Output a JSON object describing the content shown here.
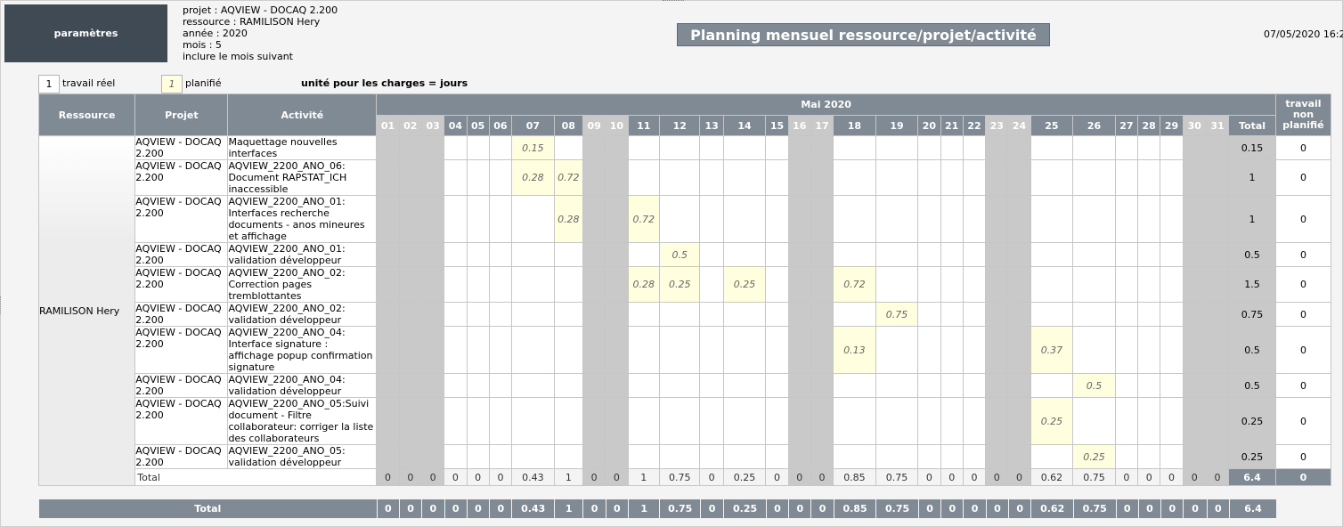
{
  "header": {
    "params_button": "paramètres",
    "info_lines": [
      "projet : AQVIEW - DOCAQ 2.200",
      "ressource : RAMILISON Hery",
      "année : 2020",
      "mois : 5",
      "inclure le mois suivant"
    ],
    "title": "Planning mensuel ressource/projet/activité",
    "datetime": "07/05/2020 16:2"
  },
  "legend": {
    "real_value": "1",
    "real_label": "travail réel",
    "planned_value": "1",
    "planned_label": "planifié",
    "unit_text": "unité pour les charges = jours"
  },
  "table": {
    "col_resource": "Ressource",
    "col_project": "Projet",
    "col_activity": "Activité",
    "month_label": "Mai 2020",
    "col_total": "Total",
    "col_unplanned": "travail non planifié",
    "days": [
      "01",
      "02",
      "03",
      "04",
      "05",
      "06",
      "07",
      "08",
      "09",
      "10",
      "11",
      "12",
      "13",
      "14",
      "15",
      "16",
      "17",
      "18",
      "19",
      "20",
      "21",
      "22",
      "23",
      "24",
      "25",
      "26",
      "27",
      "28",
      "29",
      "30",
      "31"
    ],
    "weekend_indexes": [
      0,
      1,
      2,
      8,
      9,
      15,
      16,
      22,
      23,
      29,
      30
    ],
    "resource_name": "RAMILISON Hery",
    "rows": [
      {
        "project": "AQVIEW - DOCAQ 2.200",
        "activity": "Maquettage nouvelles interfaces",
        "values": {
          "07": "0.15"
        },
        "total": "0.15",
        "unplanned": "0"
      },
      {
        "project": "AQVIEW - DOCAQ 2.200",
        "activity": "AQVIEW_2200_ANO_06: Document RAPSTAT_ICH inaccessible",
        "values": {
          "07": "0.28",
          "08": "0.72"
        },
        "total": "1",
        "unplanned": "0"
      },
      {
        "project": "AQVIEW - DOCAQ 2.200",
        "activity": "AQVIEW_2200_ANO_01: Interfaces recherche documents - anos mineures et affichage",
        "values": {
          "08": "0.28",
          "11": "0.72"
        },
        "total": "1",
        "unplanned": "0"
      },
      {
        "project": "AQVIEW - DOCAQ 2.200",
        "activity": "AQVIEW_2200_ANO_01: validation développeur",
        "values": {
          "12": "0.5"
        },
        "total": "0.5",
        "unplanned": "0"
      },
      {
        "project": "AQVIEW - DOCAQ 2.200",
        "activity": "AQVIEW_2200_ANO_02: Correction pages tremblottantes",
        "values": {
          "11": "0.28",
          "12": "0.25",
          "14": "0.25",
          "18": "0.72"
        },
        "total": "1.5",
        "unplanned": "0"
      },
      {
        "project": "AQVIEW - DOCAQ 2.200",
        "activity": "AQVIEW_2200_ANO_02: validation développeur",
        "values": {
          "19": "0.75"
        },
        "total": "0.75",
        "unplanned": "0"
      },
      {
        "project": "AQVIEW - DOCAQ 2.200",
        "activity": "AQVIEW_2200_ANO_04: Interface signature : affichage popup confirmation signature",
        "values": {
          "18": "0.13",
          "25": "0.37"
        },
        "total": "0.5",
        "unplanned": "0"
      },
      {
        "project": "AQVIEW - DOCAQ 2.200",
        "activity": "AQVIEW_2200_ANO_04: validation développeur",
        "values": {
          "26": "0.5"
        },
        "total": "0.5",
        "unplanned": "0"
      },
      {
        "project": "AQVIEW - DOCAQ 2.200",
        "activity": "AQVIEW_2200_ANO_05:Suivi document - Filtre collaborateur: corriger la liste des collaborateurs",
        "values": {
          "25": "0.25"
        },
        "total": "0.25",
        "unplanned": "0"
      },
      {
        "project": "AQVIEW - DOCAQ 2.200",
        "activity": "AQVIEW_2200_ANO_05: validation développeur",
        "values": {
          "26": "0.25"
        },
        "total": "0.25",
        "unplanned": "0"
      }
    ],
    "subtotal_label": "Total",
    "subtotal_values": [
      "0",
      "0",
      "0",
      "0",
      "0",
      "0",
      "0.43",
      "1",
      "0",
      "0",
      "1",
      "0.75",
      "0",
      "0.25",
      "0",
      "0",
      "0",
      "0.85",
      "0.75",
      "0",
      "0",
      "0",
      "0",
      "0",
      "0.62",
      "0.75",
      "0",
      "0",
      "0",
      "0",
      "0"
    ],
    "subtotal_total": "6.4",
    "subtotal_unplanned": "0"
  },
  "grand_total": {
    "label": "Total",
    "values": [
      "0",
      "0",
      "0",
      "0",
      "0",
      "0",
      "0.43",
      "1",
      "0",
      "0",
      "1",
      "0.75",
      "0",
      "0.25",
      "0",
      "0",
      "0",
      "0.85",
      "0.75",
      "0",
      "0",
      "0",
      "0",
      "0",
      "0.62",
      "0.75",
      "0",
      "0",
      "0",
      "0",
      "0"
    ],
    "total": "6.4"
  }
}
